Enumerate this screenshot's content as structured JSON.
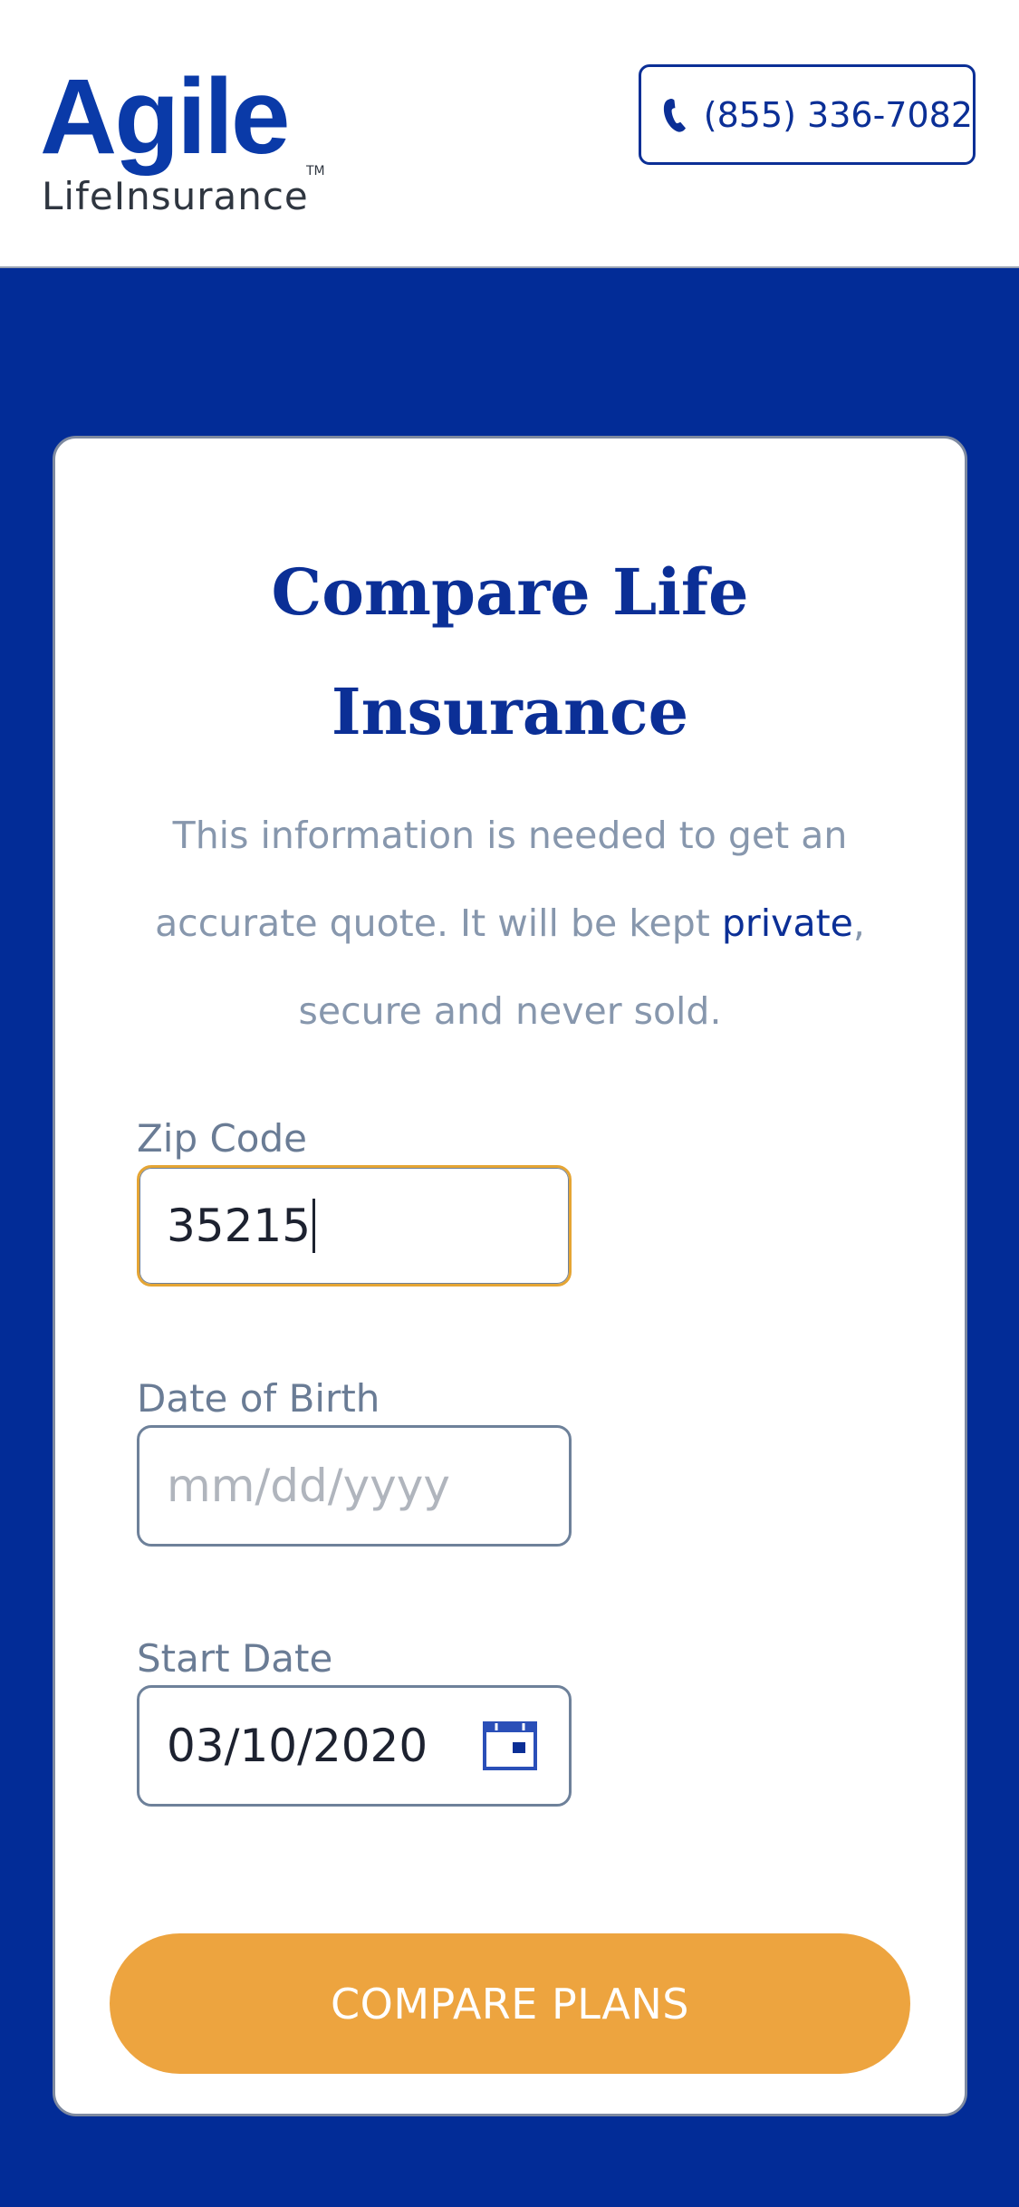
{
  "header": {
    "logo_word": "Agile",
    "logo_sub": "LifeInsurance",
    "logo_tm": "TM",
    "phone_icon": "phone-icon",
    "phone_number": "(855) 336-7082"
  },
  "form": {
    "title_line1": "Compare Life",
    "title_line2": "Insurance",
    "subtitle_line1": "This information is needed to get an",
    "subtitle_line2_a": "accurate quote. It will be kept ",
    "subtitle_link": "private",
    "subtitle_line2_b": ",",
    "subtitle_line3": "secure and never sold.",
    "zip": {
      "label": "Zip Code",
      "value": "35215"
    },
    "dob": {
      "label": "Date of Birth",
      "placeholder": "mm/dd/yyyy"
    },
    "start": {
      "label": "Start Date",
      "value": "03/10/2020",
      "icon": "calendar-icon"
    },
    "submit_label": "COMPARE PLANS"
  },
  "colors": {
    "brand_blue": "#0b2f96",
    "page_background": "#022c97",
    "accent_orange": "#eda43f",
    "focus_outline": "#e5a534",
    "muted_text": "#8797ad"
  }
}
